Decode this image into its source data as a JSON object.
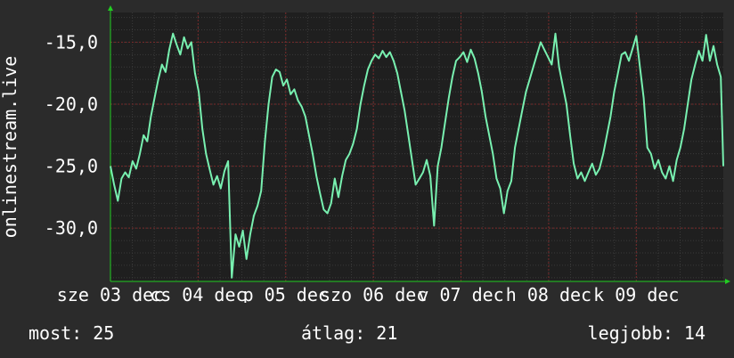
{
  "theme": {
    "background": "#2b2b2b",
    "plot_background": "#1f1f1f",
    "line_color": "#78f0b0",
    "major_grid": "#7a2a2a",
    "minor_grid": "#3a3a3a",
    "axis_arrow": "#22cc22",
    "text": "#ffffff"
  },
  "stats": {
    "current": "most: 25",
    "average": "átlag: 21",
    "best": "legjobb: 14"
  },
  "chart_data": {
    "type": "line",
    "ylabel": "onlinestream.live",
    "ylim": [
      -34.3,
      -12.6
    ],
    "yticks": [
      -15,
      -20,
      -25,
      -30
    ],
    "ytick_labels": [
      "-15,0",
      "-20,0",
      "-25,0",
      "-30,0"
    ],
    "xlim": [
      0,
      100
    ],
    "xticks": [
      {
        "x": 0,
        "label": "sze 03 dec"
      },
      {
        "x": 14.3,
        "label": "cs 04 dec"
      },
      {
        "x": 28.6,
        "label": "p 05 dec"
      },
      {
        "x": 42.9,
        "label": "szo 06 dec"
      },
      {
        "x": 57.2,
        "label": "v 07 dec"
      },
      {
        "x": 71.5,
        "label": "h 08 dec"
      },
      {
        "x": 85.8,
        "label": "k 09 dec"
      }
    ],
    "series": [
      {
        "values": [
          [
            0,
            -25.0
          ],
          [
            0.6,
            -26.5
          ],
          [
            1.2,
            -27.8
          ],
          [
            1.8,
            -26.0
          ],
          [
            2.4,
            -25.5
          ],
          [
            3.0,
            -25.9
          ],
          [
            3.6,
            -24.6
          ],
          [
            4.2,
            -25.2
          ],
          [
            4.8,
            -24.0
          ],
          [
            5.4,
            -22.5
          ],
          [
            6.0,
            -23.0
          ],
          [
            6.6,
            -21.0
          ],
          [
            7.2,
            -19.5
          ],
          [
            7.8,
            -18.0
          ],
          [
            8.4,
            -16.8
          ],
          [
            9.0,
            -17.4
          ],
          [
            9.6,
            -15.6
          ],
          [
            10.2,
            -14.3
          ],
          [
            10.8,
            -15.2
          ],
          [
            11.4,
            -16.0
          ],
          [
            12.0,
            -14.6
          ],
          [
            12.6,
            -15.5
          ],
          [
            13.2,
            -15.0
          ],
          [
            13.8,
            -17.5
          ],
          [
            14.4,
            -19.0
          ],
          [
            15.0,
            -22.0
          ],
          [
            15.6,
            -24.0
          ],
          [
            16.2,
            -25.3
          ],
          [
            16.8,
            -26.5
          ],
          [
            17.4,
            -25.8
          ],
          [
            18.0,
            -26.8
          ],
          [
            18.6,
            -25.4
          ],
          [
            19.2,
            -24.6
          ],
          [
            19.8,
            -34.0
          ],
          [
            20.4,
            -30.5
          ],
          [
            21.0,
            -31.5
          ],
          [
            21.6,
            -30.2
          ],
          [
            22.2,
            -32.5
          ],
          [
            22.8,
            -30.5
          ],
          [
            23.4,
            -29.0
          ],
          [
            24.0,
            -28.2
          ],
          [
            24.6,
            -27.0
          ],
          [
            25.2,
            -23.0
          ],
          [
            25.8,
            -20.0
          ],
          [
            26.4,
            -17.8
          ],
          [
            27.0,
            -17.2
          ],
          [
            27.6,
            -17.4
          ],
          [
            28.2,
            -18.5
          ],
          [
            28.8,
            -18.0
          ],
          [
            29.4,
            -19.2
          ],
          [
            30.0,
            -18.8
          ],
          [
            30.6,
            -19.7
          ],
          [
            31.2,
            -20.2
          ],
          [
            31.8,
            -21.0
          ],
          [
            32.4,
            -22.5
          ],
          [
            33.0,
            -24.0
          ],
          [
            33.6,
            -25.8
          ],
          [
            34.2,
            -27.2
          ],
          [
            34.8,
            -28.5
          ],
          [
            35.4,
            -28.8
          ],
          [
            36.0,
            -28.0
          ],
          [
            36.6,
            -26.0
          ],
          [
            37.2,
            -27.5
          ],
          [
            37.8,
            -25.8
          ],
          [
            38.4,
            -24.5
          ],
          [
            39.0,
            -24.0
          ],
          [
            39.6,
            -23.2
          ],
          [
            40.2,
            -22.0
          ],
          [
            40.8,
            -20.0
          ],
          [
            41.4,
            -18.5
          ],
          [
            42.0,
            -17.2
          ],
          [
            42.6,
            -16.5
          ],
          [
            43.2,
            -16.0
          ],
          [
            43.8,
            -16.3
          ],
          [
            44.4,
            -15.7
          ],
          [
            45.0,
            -16.2
          ],
          [
            45.6,
            -15.8
          ],
          [
            46.2,
            -16.5
          ],
          [
            46.8,
            -17.5
          ],
          [
            47.4,
            -19.0
          ],
          [
            48.0,
            -20.5
          ],
          [
            48.6,
            -22.5
          ],
          [
            49.2,
            -24.5
          ],
          [
            49.8,
            -26.5
          ],
          [
            50.4,
            -26.0
          ],
          [
            51.0,
            -25.5
          ],
          [
            51.6,
            -24.5
          ],
          [
            52.2,
            -25.8
          ],
          [
            52.8,
            -29.8
          ],
          [
            53.4,
            -25.0
          ],
          [
            54.0,
            -23.5
          ],
          [
            54.6,
            -21.5
          ],
          [
            55.2,
            -19.5
          ],
          [
            55.8,
            -17.8
          ],
          [
            56.4,
            -16.5
          ],
          [
            57.0,
            -16.2
          ],
          [
            57.6,
            -15.8
          ],
          [
            58.2,
            -16.6
          ],
          [
            58.8,
            -15.6
          ],
          [
            59.4,
            -16.3
          ],
          [
            60.0,
            -17.5
          ],
          [
            60.6,
            -19.0
          ],
          [
            61.2,
            -21.0
          ],
          [
            61.8,
            -22.5
          ],
          [
            62.4,
            -24.0
          ],
          [
            63.0,
            -26.0
          ],
          [
            63.6,
            -26.8
          ],
          [
            64.2,
            -28.8
          ],
          [
            64.8,
            -27.0
          ],
          [
            65.4,
            -26.2
          ],
          [
            66.0,
            -23.5
          ],
          [
            66.6,
            -22.0
          ],
          [
            67.2,
            -20.5
          ],
          [
            67.8,
            -19.0
          ],
          [
            68.4,
            -18.0
          ],
          [
            69.0,
            -17.0
          ],
          [
            69.6,
            -16.0
          ],
          [
            70.2,
            -15.0
          ],
          [
            70.8,
            -15.6
          ],
          [
            71.4,
            -16.2
          ],
          [
            72.0,
            -16.8
          ],
          [
            72.6,
            -14.3
          ],
          [
            73.2,
            -17.0
          ],
          [
            73.8,
            -18.5
          ],
          [
            74.4,
            -20.0
          ],
          [
            75.0,
            -22.5
          ],
          [
            75.6,
            -24.8
          ],
          [
            76.2,
            -26.0
          ],
          [
            76.8,
            -25.5
          ],
          [
            77.4,
            -26.2
          ],
          [
            78.0,
            -25.5
          ],
          [
            78.6,
            -24.8
          ],
          [
            79.2,
            -25.7
          ],
          [
            79.8,
            -25.2
          ],
          [
            80.4,
            -24.0
          ],
          [
            81.0,
            -22.5
          ],
          [
            81.6,
            -21.0
          ],
          [
            82.2,
            -19.0
          ],
          [
            82.8,
            -17.5
          ],
          [
            83.4,
            -16.0
          ],
          [
            84.0,
            -15.8
          ],
          [
            84.6,
            -16.5
          ],
          [
            85.2,
            -15.5
          ],
          [
            85.8,
            -14.5
          ],
          [
            86.4,
            -17.0
          ],
          [
            87.0,
            -19.5
          ],
          [
            87.6,
            -23.5
          ],
          [
            88.2,
            -24.0
          ],
          [
            88.8,
            -25.2
          ],
          [
            89.4,
            -24.5
          ],
          [
            90.0,
            -25.5
          ],
          [
            90.6,
            -26.0
          ],
          [
            91.2,
            -25.0
          ],
          [
            91.8,
            -26.2
          ],
          [
            92.4,
            -24.5
          ],
          [
            93.0,
            -23.5
          ],
          [
            93.6,
            -22.0
          ],
          [
            94.2,
            -20.0
          ],
          [
            94.8,
            -18.0
          ],
          [
            95.4,
            -16.8
          ],
          [
            96.0,
            -15.7
          ],
          [
            96.6,
            -16.5
          ],
          [
            97.2,
            -14.4
          ],
          [
            97.8,
            -16.5
          ],
          [
            98.4,
            -15.3
          ],
          [
            99.0,
            -16.8
          ],
          [
            99.6,
            -17.8
          ],
          [
            100.0,
            -25.0
          ]
        ]
      }
    ]
  }
}
